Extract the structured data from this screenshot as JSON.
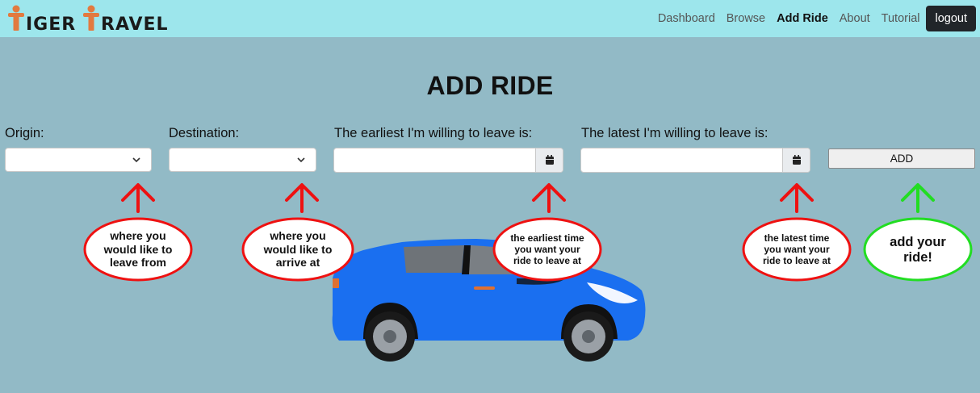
{
  "logo": {
    "text": "TigerTravel",
    "color_orange": "#e27a3f",
    "color_dark": "#1a1a1a"
  },
  "nav": {
    "items": [
      {
        "label": "Dashboard",
        "active": false
      },
      {
        "label": "Browse",
        "active": false
      },
      {
        "label": "Add Ride",
        "active": true
      },
      {
        "label": "About",
        "active": false
      },
      {
        "label": "Tutorial",
        "active": false
      }
    ],
    "logout_label": "logout"
  },
  "page_title": "ADD RIDE",
  "form": {
    "origin_label": "Origin:",
    "origin_value": "",
    "destination_label": "Destination:",
    "destination_value": "",
    "earliest_label": "The earliest I'm willing to leave is:",
    "earliest_value": "",
    "latest_label": "The latest I'm willing to leave is:",
    "latest_value": "",
    "add_label": "ADD"
  },
  "hints": {
    "origin": [
      "where you",
      "would like to",
      "leave from"
    ],
    "destination": [
      "where you",
      "would like to",
      "arrive at"
    ],
    "earliest": [
      "the earliest time",
      "you want your",
      "ride to leave at"
    ],
    "latest": [
      "the latest time",
      "you want your",
      "ride to leave at"
    ],
    "add": [
      "add your",
      "ride!"
    ]
  },
  "colors": {
    "background": "#92bac6",
    "navbar": "#9de6ec",
    "hint_arrow_red": "#ee1111",
    "hint_arrow_green": "#22dd22",
    "car_body": "#1a6ff0"
  }
}
